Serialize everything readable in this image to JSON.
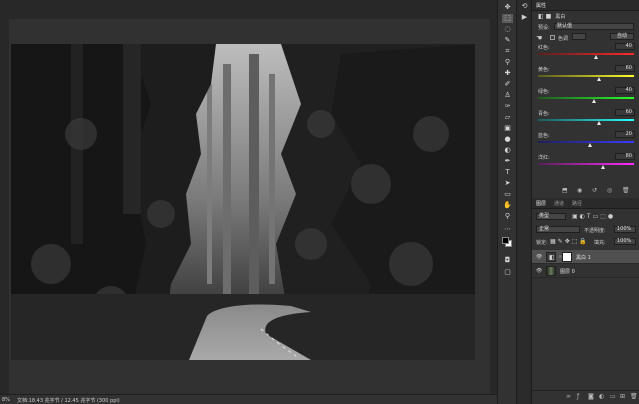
{
  "status": {
    "zoom": "8%",
    "info": "文档:18.43 兆字节 / 12.45 兆字节 (300 ppi)"
  },
  "properties": {
    "tabs": [
      "属性"
    ],
    "layer_type_label": "黑白",
    "preset_label": "预设:",
    "preset_value": "默认值",
    "tint_label": "色调",
    "auto_label": "自动",
    "sliders": [
      {
        "label": "红色:",
        "value": "40",
        "fraction": 0.6
      },
      {
        "label": "黄色:",
        "value": "60",
        "fraction": 0.64
      },
      {
        "label": "绿色:",
        "value": "40",
        "fraction": 0.58
      },
      {
        "label": "青色:",
        "value": "60",
        "fraction": 0.64
      },
      {
        "label": "蓝色:",
        "value": "20",
        "fraction": 0.54
      },
      {
        "label": "洋红:",
        "value": "80",
        "fraction": 0.68
      }
    ],
    "slider_colors": [
      [
        "#5a1f1f",
        "#ff2a2a"
      ],
      [
        "#5a5a1f",
        "#ffff2a"
      ],
      [
        "#1f5a1f",
        "#2aff2a"
      ],
      [
        "#1f5a5a",
        "#2affff"
      ],
      [
        "#1f1f5a",
        "#3a3aff"
      ],
      [
        "#5a1f5a",
        "#ff2aff"
      ]
    ]
  },
  "layers": {
    "tabs": [
      "图层",
      "通道",
      "路径"
    ],
    "filter_label": "类型",
    "blend_mode": "正常",
    "opacity_label": "不透明度:",
    "opacity_value": "100%",
    "lock_label": "锁定:",
    "fill_label": "填充:",
    "fill_value": "100%",
    "items": [
      {
        "name": "黑白 1",
        "kind": "adjustment",
        "selected": true
      },
      {
        "name": "图层 0",
        "kind": "pixel",
        "selected": false
      }
    ]
  },
  "tools": [
    "move",
    "marquee",
    "lasso",
    "quick-select",
    "crop",
    "eyedropper",
    "healing",
    "brush",
    "stamp",
    "history-brush",
    "eraser",
    "gradient",
    "blur",
    "dodge",
    "pen",
    "type",
    "path-select",
    "rectangle",
    "hand",
    "zoom"
  ],
  "colors": {
    "foreground": "#000000",
    "background": "#ffffff"
  }
}
